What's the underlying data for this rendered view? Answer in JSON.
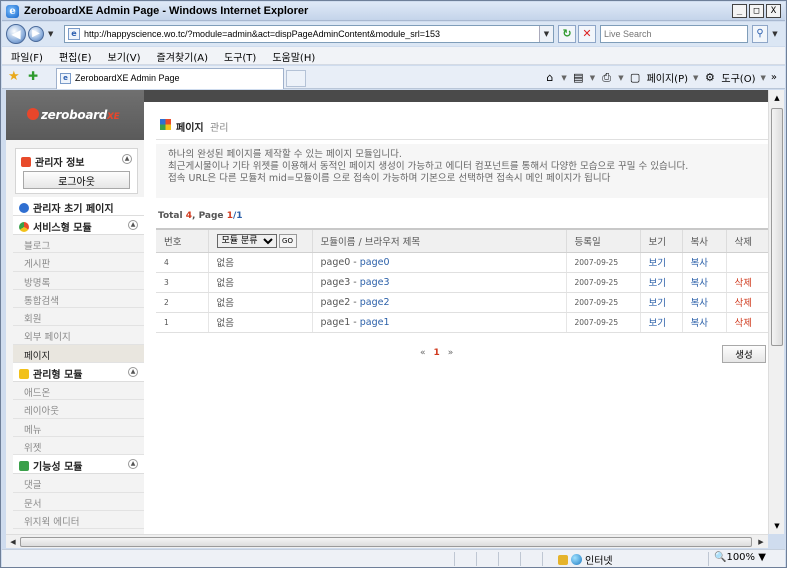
{
  "window": {
    "title": "ZeroboardXE Admin Page - Windows Internet Explorer",
    "btn_min": "_",
    "btn_max": "□",
    "btn_close": "X"
  },
  "addressbar": {
    "url": "http://happyscience.wo.tc/?module=admin&act=dispPageAdminContent&module_srl=153",
    "search_placeholder": "Live Search"
  },
  "menu": [
    "파일(F)",
    "편집(E)",
    "보기(V)",
    "즐겨찾기(A)",
    "도구(T)",
    "도움말(H)"
  ],
  "tab": {
    "label": "ZeroboardXE Admin Page"
  },
  "commandbar": {
    "page": "페이지(P)",
    "tools": "도구(O)",
    "more": "»"
  },
  "logo": {
    "text": "zeroboard",
    "suffix": "XE"
  },
  "sidebar": {
    "admin_info": "관리자 정보",
    "logout": "로그아웃",
    "admin_home": "관리자 초기 페이지",
    "groups": [
      {
        "label": "서비스형 모듈",
        "icon_color": "#2f6fd1",
        "items": [
          "블로그",
          "게시판",
          "방명록",
          "통합검색",
          "회원",
          "외부 페이지",
          "페이지"
        ]
      },
      {
        "label": "관리형 모듈",
        "icon_color": "#f2c11a",
        "items": [
          "애드온",
          "레이아웃",
          "메뉴",
          "위젯"
        ]
      },
      {
        "label": "기능성 모듈",
        "icon_color": "#3aa04a",
        "items": [
          "댓글",
          "문서",
          "위지윅 에디터"
        ]
      }
    ],
    "active_item": "페이지"
  },
  "main": {
    "title": "페이지",
    "title_sub": "관리",
    "desc": [
      "하나의 완성된 페이지를 제작할 수 있는 페이지 모듈입니다.",
      "최근게시물이나 기타 위젯를 이용해서 동적인 페이지 생성이 가능하고 에디터 컴포넌트를 통해서 다양한 모습으로 꾸밀 수 있습니다.",
      "접속 URL은 다른 모듈처 mid=모듈이름 으로 접속이 가능하며 기본으로 선택하면 접속시 메인 페이지가 됩니다"
    ],
    "total_label": "Total",
    "total_count": "4",
    "page_label": "Page",
    "page_current": "1",
    "page_total": "/1",
    "columns": [
      "번호",
      "",
      "모듈이름 / 브라우저 제목",
      "등록일",
      "보기",
      "복사",
      "삭제"
    ],
    "filter_select": "모듈 분류",
    "filter_go": "GO",
    "rows": [
      {
        "no": "4",
        "category": "없음",
        "name": "page0",
        "title": "page0",
        "date": "2007-09-25",
        "view": "보기",
        "copy": "복사",
        "delete": ""
      },
      {
        "no": "3",
        "category": "없음",
        "name": "page3",
        "title": "page3",
        "date": "2007-09-25",
        "view": "보기",
        "copy": "복사",
        "delete": "삭제"
      },
      {
        "no": "2",
        "category": "없음",
        "name": "page2",
        "title": "page2",
        "date": "2007-09-25",
        "view": "보기",
        "copy": "복사",
        "delete": "삭제"
      },
      {
        "no": "1",
        "category": "없음",
        "name": "page1",
        "title": "page1",
        "date": "2007-09-25",
        "view": "보기",
        "copy": "복사",
        "delete": "삭제"
      }
    ],
    "pager": {
      "prev": "«",
      "current": "1",
      "next": "»"
    },
    "create_btn": "생성"
  },
  "statusbar": {
    "zone": "인터넷",
    "zoom": "100%"
  }
}
